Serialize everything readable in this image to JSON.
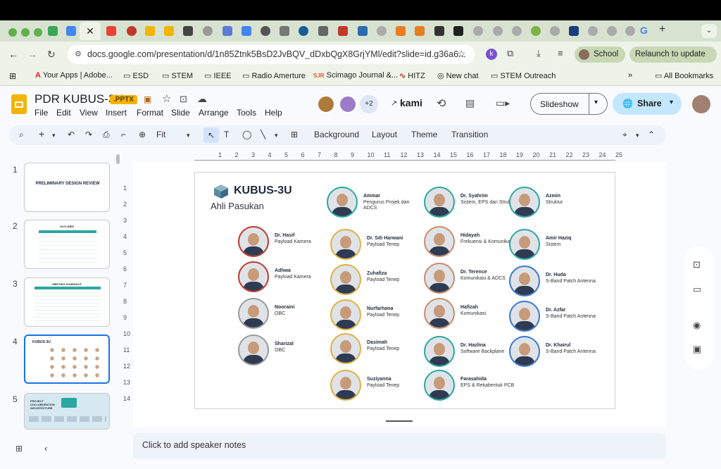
{
  "browser": {
    "url": "docs.google.com/presentation/d/1n85Ztnk5BsD2JvBQV_dDxbQgX8GrjYMl/edit?slide=id.g36a6...",
    "profile_label": "School",
    "relaunch_label": "Relaunch to update",
    "bookmarks": [
      "Your Apps | Adobe...",
      "ESD",
      "STEM",
      "IEEE",
      "Radio Amerture",
      "Scimago Journal &...",
      "HITZ",
      "New chat",
      "STEM Outreach",
      "All Bookmarks"
    ]
  },
  "app": {
    "title": "PDR KUBUS-3U",
    "badge": ".PPTX",
    "menu": [
      "File",
      "Edit",
      "View",
      "Insert",
      "Format",
      "Slide",
      "Arrange",
      "Tools",
      "Help"
    ],
    "collab_count": "+2",
    "kami_label": "kami",
    "slideshow_label": "Slideshow",
    "share_label": "Share"
  },
  "toolbar": {
    "zoom": "Fit",
    "items": [
      "Background",
      "Layout",
      "Theme",
      "Transition"
    ]
  },
  "ruler_labels": [
    "1",
    "2",
    "3",
    "4",
    "5",
    "6",
    "7",
    "8",
    "9",
    "10",
    "11",
    "12",
    "13",
    "14",
    "15",
    "16",
    "17",
    "18",
    "19",
    "20",
    "21",
    "22",
    "23",
    "24",
    "25"
  ],
  "vruler_labels": [
    "1",
    "2",
    "3",
    "4",
    "5",
    "6",
    "7",
    "8",
    "9",
    "10",
    "11",
    "12",
    "13",
    "14"
  ],
  "thumbnails": [
    {
      "num": "1",
      "title": "PRELIMINARY DESIGN REVIEW"
    },
    {
      "num": "2",
      "title": "OUTLINES"
    },
    {
      "num": "3",
      "title": "MEETING SCHEDULE"
    },
    {
      "num": "4",
      "title": "KUBUS-3U"
    },
    {
      "num": "5",
      "title": "PROJECT COLLABORATION ARCHITECTURE"
    }
  ],
  "slide": {
    "logo_text": "KUBUS-3U",
    "subtitle": "Ahli Pasukan",
    "members": [
      {
        "name": "Ammar",
        "role": "Pengurus Projek dan ADCS",
        "ring": "#2aa7a0"
      },
      {
        "name": "Dr. Syahrim",
        "role": "Sistem, EPS dan Struktur",
        "ring": "#2aa7a0"
      },
      {
        "name": "Azmin",
        "role": "Struktur",
        "ring": "#2aa7a0"
      },
      {
        "name": "Dr. Hasif",
        "role": "Payload Kamera",
        "ring": "#c0392b"
      },
      {
        "name": "Dr. Siti Harwani",
        "role": "Payload Tenep",
        "ring": "#e0b040"
      },
      {
        "name": "Hidayah",
        "role": "Frekuensi & Komunikasi",
        "ring": "#c98a6b"
      },
      {
        "name": "Amir Haziq",
        "role": "Sistem",
        "ring": "#2aa7a0"
      },
      {
        "name": "Adhwa",
        "role": "Payload Kamera",
        "ring": "#c0392b"
      },
      {
        "name": "Zuhafiza",
        "role": "Payload Tenep",
        "ring": "#e0b040"
      },
      {
        "name": "Dr. Terence",
        "role": "Komunikasi & ADCS",
        "ring": "#c98a6b"
      },
      {
        "name": "Dr. Huda",
        "role": "S-Band Patch Antenna",
        "ring": "#3a78d0"
      },
      {
        "name": "Nooraini",
        "role": "OBC",
        "ring": "#999"
      },
      {
        "name": "Nurfarhana",
        "role": "Payload Tenep",
        "ring": "#e0b040"
      },
      {
        "name": "Hafizah",
        "role": "Komunikasi",
        "ring": "#c98a6b"
      },
      {
        "name": "Dr. Azfar",
        "role": "S-Band Patch Antenna",
        "ring": "#3a78d0"
      },
      {
        "name": "Sharizal",
        "role": "OBC",
        "ring": "#999"
      },
      {
        "name": "Dasimah",
        "role": "Payload Tenep",
        "ring": "#e0b040"
      },
      {
        "name": "Dr. Hazlina",
        "role": "Software Backplane",
        "ring": "#2aa7a0"
      },
      {
        "name": "Dr. Khairul",
        "role": "S-Band Patch Antenna",
        "ring": "#3a78d0"
      },
      {
        "name": "Suziyanna",
        "role": "Payload Tenep",
        "ring": "#e0b040"
      },
      {
        "name": "Farasahida",
        "role": "EPS & Rekabentuk PCB",
        "ring": "#2aa7a0"
      }
    ]
  },
  "notes_placeholder": "Click to add speaker notes"
}
